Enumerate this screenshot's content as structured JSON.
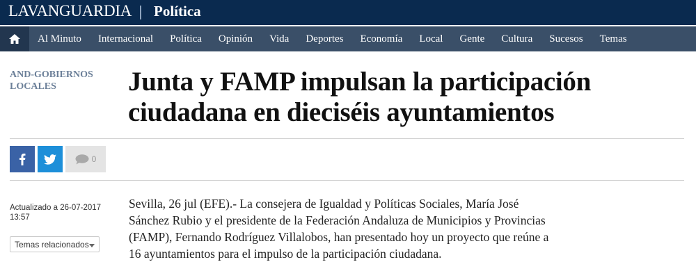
{
  "header": {
    "logo": "LAVANGUARDIA",
    "section": "Política"
  },
  "nav": {
    "home_icon": "home-icon",
    "items": [
      "Al Minuto",
      "Internacional",
      "Política",
      "Opinión",
      "Vida",
      "Deportes",
      "Economía",
      "Local",
      "Gente",
      "Cultura",
      "Sucesos",
      "Temas"
    ]
  },
  "article": {
    "tag": "AND-GOBIERNOS LOCALES",
    "headline": "Junta y FAMP impulsan la participación ciudadana en dieciséis ayuntamientos",
    "comments_count": "0",
    "updated": "Actualizado a 26-07-2017 13:57",
    "related_label": "Temas relacionados",
    "body": "Sevilla, 26 jul (EFE).- La consejera de Igualdad y Políticas Sociales, María José Sánchez Rubio y el presidente de la Federación Andaluza de Municipios y Provincias (FAMP), Fernando Rodríguez Villalobos, han presentado hoy un proyecto que reúne a 16 ayuntamientos para el impulso de la participación ciudadana."
  },
  "colors": {
    "topbar": "#0a2a4f",
    "navbar": "#3a4f68",
    "facebook": "#3a62a6",
    "twitter": "#1d8fd9"
  }
}
